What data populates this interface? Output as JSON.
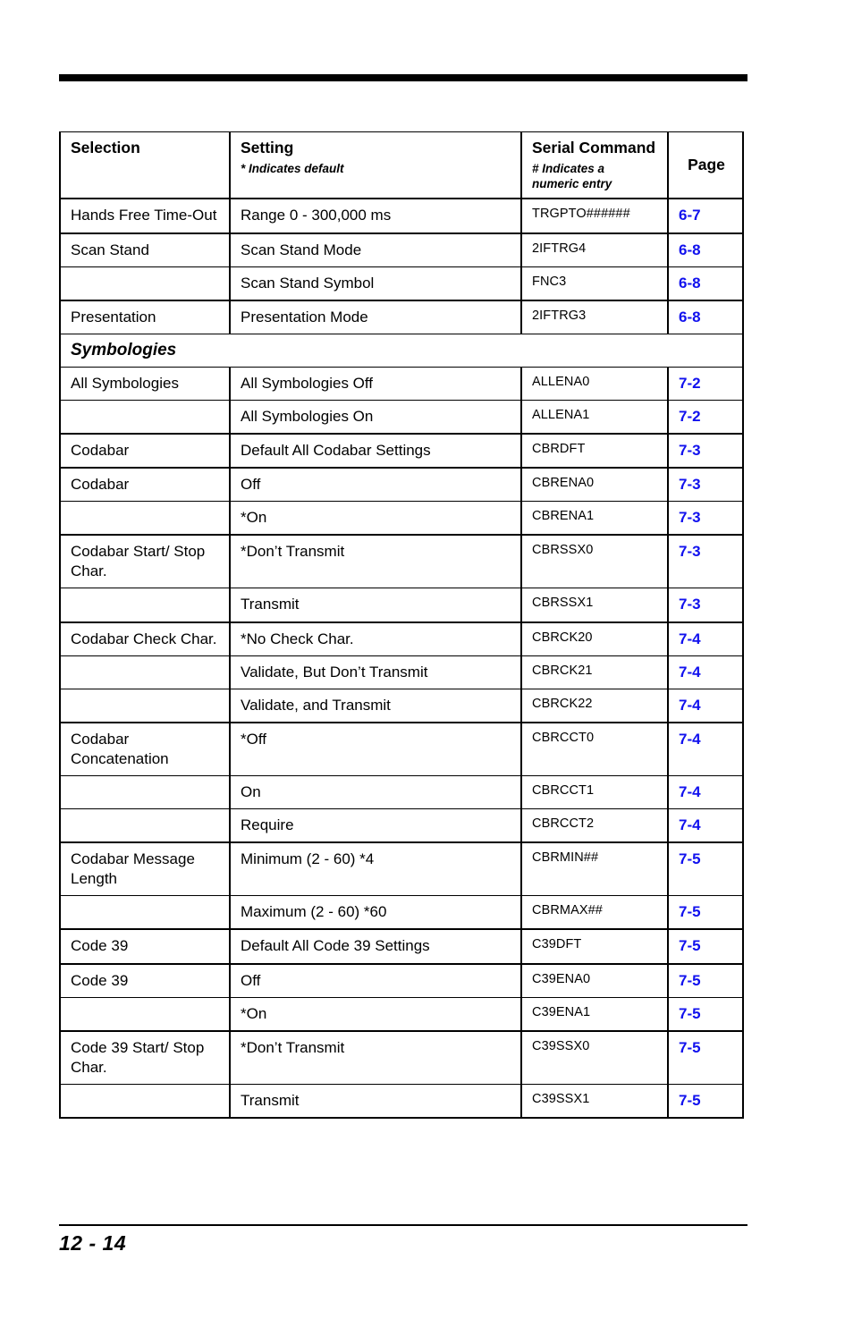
{
  "page": {
    "folio": "12 - 14",
    "link_color": "#1111ee",
    "section_band_color": "#e4e4e4"
  },
  "table": {
    "headers": {
      "selection": "Selection",
      "setting": "Setting",
      "setting_note": "* Indicates default",
      "serial_command": "Serial Command",
      "serial_command_note": "# Indicates a\nnumeric entry",
      "page": "Page"
    },
    "rows": [
      {
        "selection": "Hands Free Time-Out",
        "setting": "Range 0 - 300,000 ms",
        "command": "TRGPTO######",
        "page": "6-7",
        "group_start": true,
        "tall": true
      },
      {
        "selection": "Scan Stand",
        "setting": "Scan Stand Mode",
        "command": "2IFTRG4",
        "page": "6-8",
        "group_start": true
      },
      {
        "selection": "",
        "setting": "Scan Stand Symbol",
        "command": "FNC3",
        "page": "6-8"
      },
      {
        "selection": "Presentation",
        "setting": "Presentation Mode",
        "command": "2IFTRG3",
        "page": "6-8",
        "group_start": true
      },
      {
        "section": "Symbologies"
      },
      {
        "selection": "All Symbologies",
        "setting": "All Symbologies Off",
        "command": "ALLENA0",
        "page": "7-2"
      },
      {
        "selection": "",
        "setting": "All Symbologies On",
        "command": "ALLENA1",
        "page": "7-2"
      },
      {
        "selection": "Codabar",
        "setting": "Default All Codabar Settings",
        "command": "CBRDFT",
        "page": "7-3",
        "group_start": true,
        "tall": true
      },
      {
        "selection": "Codabar",
        "setting": "Off",
        "command": "CBRENA0",
        "page": "7-3",
        "group_start": true
      },
      {
        "selection": "",
        "setting": "*On",
        "command": "CBRENA1",
        "page": "7-3"
      },
      {
        "selection": "Codabar Start/ Stop Char.",
        "setting": "*Don’t Transmit",
        "command": "CBRSSX0",
        "page": "7-3",
        "group_start": true
      },
      {
        "selection": "",
        "setting": "Transmit",
        "command": "CBRSSX1",
        "page": "7-3"
      },
      {
        "selection": "Codabar Check Char.",
        "setting": "*No Check Char.",
        "command": "CBRCK20",
        "page": "7-4",
        "group_start": true
      },
      {
        "selection": "",
        "setting": "Validate, But Don’t Transmit",
        "command": "CBRCK21",
        "page": "7-4"
      },
      {
        "selection": "",
        "setting": "Validate, and Transmit",
        "command": "CBRCK22",
        "page": "7-4"
      },
      {
        "selection": "Codabar Concatenation",
        "setting": "*Off",
        "command": "CBRCCT0",
        "page": "7-4",
        "group_start": true
      },
      {
        "selection": "",
        "setting": "On",
        "command": "CBRCCT1",
        "page": "7-4"
      },
      {
        "selection": "",
        "setting": "Require",
        "command": "CBRCCT2",
        "page": "7-4"
      },
      {
        "selection": "Codabar Message Length",
        "setting": "Minimum (2 - 60)  *4",
        "command": "CBRMIN##",
        "page": "7-5",
        "group_start": true
      },
      {
        "selection": "",
        "setting": "Maximum (2 - 60)  *60",
        "command": "CBRMAX##",
        "page": "7-5"
      },
      {
        "selection": "Code 39",
        "setting": "Default All Code 39 Settings",
        "command": "C39DFT",
        "page": "7-5",
        "group_start": true,
        "tall": true
      },
      {
        "selection": "Code 39",
        "setting": "Off",
        "command": "C39ENA0",
        "page": "7-5",
        "group_start": true
      },
      {
        "selection": "",
        "setting": "*On",
        "command": "C39ENA1",
        "page": "7-5"
      },
      {
        "selection": "Code 39 Start/ Stop Char.",
        "setting": "*Don’t Transmit",
        "command": "C39SSX0",
        "page": "7-5",
        "group_start": true
      },
      {
        "selection": "",
        "setting": "Transmit",
        "command": "C39SSX1",
        "page": "7-5",
        "last": true
      }
    ]
  }
}
